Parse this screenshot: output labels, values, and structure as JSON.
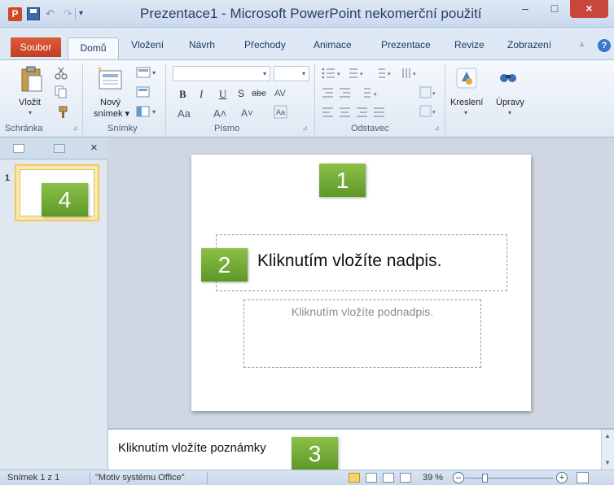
{
  "window": {
    "title": "Prezentace1 - Microsoft PowerPoint nekomerční použití",
    "app_icon_letter": "P",
    "controls": {
      "minimize": "–",
      "maximize": "□",
      "close": "×"
    }
  },
  "quick_access": {
    "undo": "↶",
    "redo": "↷",
    "more": "▾"
  },
  "tabs": {
    "file": "Soubor",
    "home": "Domů",
    "insert": "Vložení",
    "design": "Návrh",
    "transitions": "Přechody",
    "animations": "Animace",
    "slideshow": "Prezentace",
    "review": "Revize",
    "view": "Zobrazení",
    "help_icon": "?",
    "minimize_ribbon": "▵"
  },
  "ribbon": {
    "clipboard": {
      "group": "Schránka",
      "paste": "Vložit",
      "paste_arrow": "▾"
    },
    "slides": {
      "group": "Snímky",
      "new_slide_line1": "Nový",
      "new_slide_line2": "snímek ▾"
    },
    "font": {
      "group": "Písmo",
      "bold": "B",
      "italic": "I",
      "underline": "U",
      "shadow": "S",
      "strike": "abc",
      "spacing": "AV",
      "font_color": "A",
      "change_case": "Aa",
      "grow": "A˄",
      "shrink": "A˅"
    },
    "paragraph": {
      "group": "Odstavec"
    },
    "drawing": {
      "label": "Kreslení",
      "arrow": "▾"
    },
    "editing": {
      "label": "Úpravy",
      "arrow": "▾"
    }
  },
  "left_panel": {
    "close": "×",
    "slide_number": "1"
  },
  "slide": {
    "title_placeholder": "Kliknutím vložíte nadpis.",
    "subtitle_placeholder": "Kliknutím vložíte podnadpis."
  },
  "notes": {
    "placeholder": "Kliknutím vložíte poznámky"
  },
  "callouts": {
    "c1": "1",
    "c2": "2",
    "c3": "3",
    "c4": "4"
  },
  "status": {
    "slide_info": "Snímek 1 z 1",
    "theme": "\"Motiv systému Office\"",
    "zoom": "39 %",
    "zoom_out": "–",
    "zoom_in": "+"
  },
  "colors": {
    "file_tab": "#d24726",
    "close_button": "#c9463d",
    "callout": "#78b13a",
    "thumbnail_selected": "#fbe9a9"
  }
}
